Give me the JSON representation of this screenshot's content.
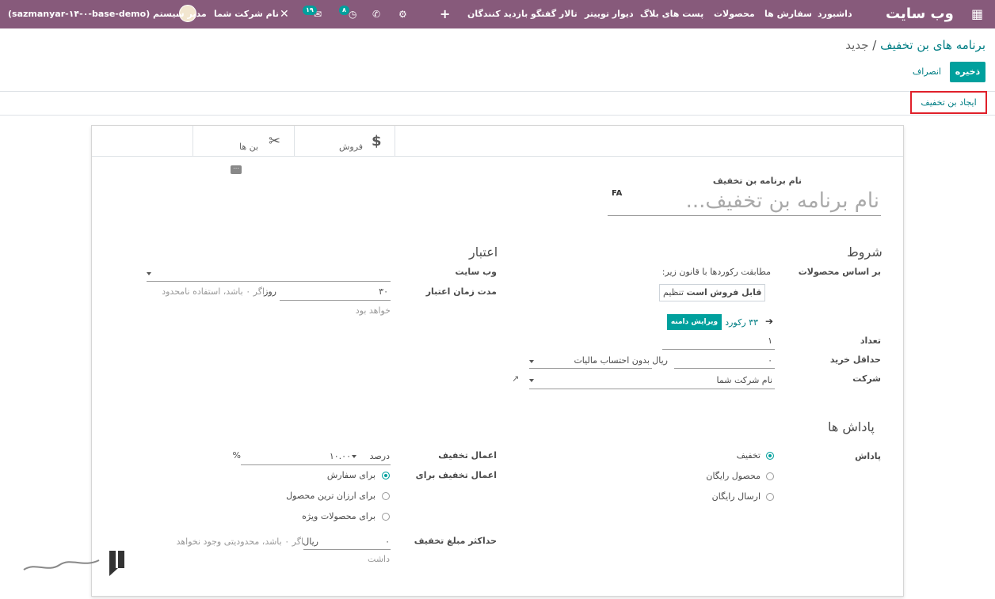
{
  "navbar": {
    "apps_icon": "grid-apps-icon",
    "brand": "وب سایت",
    "menu": [
      "داشبورد",
      "سفارش ها",
      "محصولات",
      "پست های بلاگ",
      "دیوار توییتر",
      "تالار گفتگو",
      "بازدید کنندگان"
    ],
    "add_icon": "plus-icon",
    "debug_icon": "bug-icon",
    "phone_icon": "phone-icon",
    "activity_count": "۸",
    "messages_count": "۱۹",
    "close_icon": "close-icon",
    "company": "نام شرکت شما",
    "user": "مدیر سیستم (sazmanyar-۱۴-۰-base-demo)"
  },
  "breadcrumb": {
    "parent": "برنامه های بن تخفیف",
    "separator": "/",
    "current": "جدید"
  },
  "buttons": {
    "save": "ذخیره",
    "discard": "انصراف",
    "create_coupon": "ایجاد بن تخفیف"
  },
  "smart_buttons": {
    "sales": "فروش",
    "coupons": "بن ها"
  },
  "form": {
    "name_label": "نام برنامه بن تخفیف",
    "name_placeholder": "نام برنامه بن تخفیف...",
    "lang_tag": "FA",
    "conditions": {
      "title": "شروط",
      "based_on_products_label": "بر اساس محصولات",
      "match_text": "مطابقت رکوردها با قانون زیر:",
      "domain_field": "قابل فروش",
      "domain_op": "است",
      "domain_value": "تنظیم",
      "record_count": "۳۳ رکورد",
      "edit_domain": "ویرایش دامنه",
      "quantity_label": "تعداد",
      "quantity_value": "۱",
      "min_purchase_label": "حداقل خرید",
      "min_purchase_value": "۰",
      "min_purchase_currency": "ریال",
      "min_purchase_tax": "بدون احتساب مالیات",
      "company_label": "شرکت",
      "company_value": "نام شرکت شما"
    },
    "validity": {
      "title": "اعتبار",
      "website_label": "وب سایت",
      "duration_label": "مدت زمان اعتبار",
      "duration_value": "۳۰",
      "duration_unit": "روز",
      "duration_help_1": "اگر ۰ باشد، استفاده نامحدود",
      "duration_help_2": "خواهد بود"
    },
    "rewards": {
      "title": "پاداش ها",
      "reward_label": "پاداش",
      "options": [
        {
          "label": "تخفیف",
          "selected": true
        },
        {
          "label": "محصول رایگان",
          "selected": false
        },
        {
          "label": "ارسال رایگان",
          "selected": false
        }
      ],
      "apply_discount_label": "اعمال تخفیف",
      "discount_type": "درصد",
      "discount_value": "۱۰.۰۰",
      "discount_unit": "%",
      "apply_on_label": "اعمال تخفیف برای",
      "apply_on_options": [
        {
          "label": "برای سفارش",
          "selected": true
        },
        {
          "label": "برای ارزان ترین محصول",
          "selected": false
        },
        {
          "label": "برای محصولات ویژه",
          "selected": false
        }
      ],
      "max_discount_label": "حداکثر مبلغ تخفیف",
      "max_discount_value": "۰",
      "max_discount_currency": "ریال",
      "max_discount_help_1": "اگر ۰ باشد، محدودیتی وجود نخواهد",
      "max_discount_help_2": "داشت"
    }
  },
  "colors": {
    "navbar": "#875a7b",
    "primary": "#00a09d",
    "link": "#017e84",
    "highlight": "#e0202a"
  }
}
